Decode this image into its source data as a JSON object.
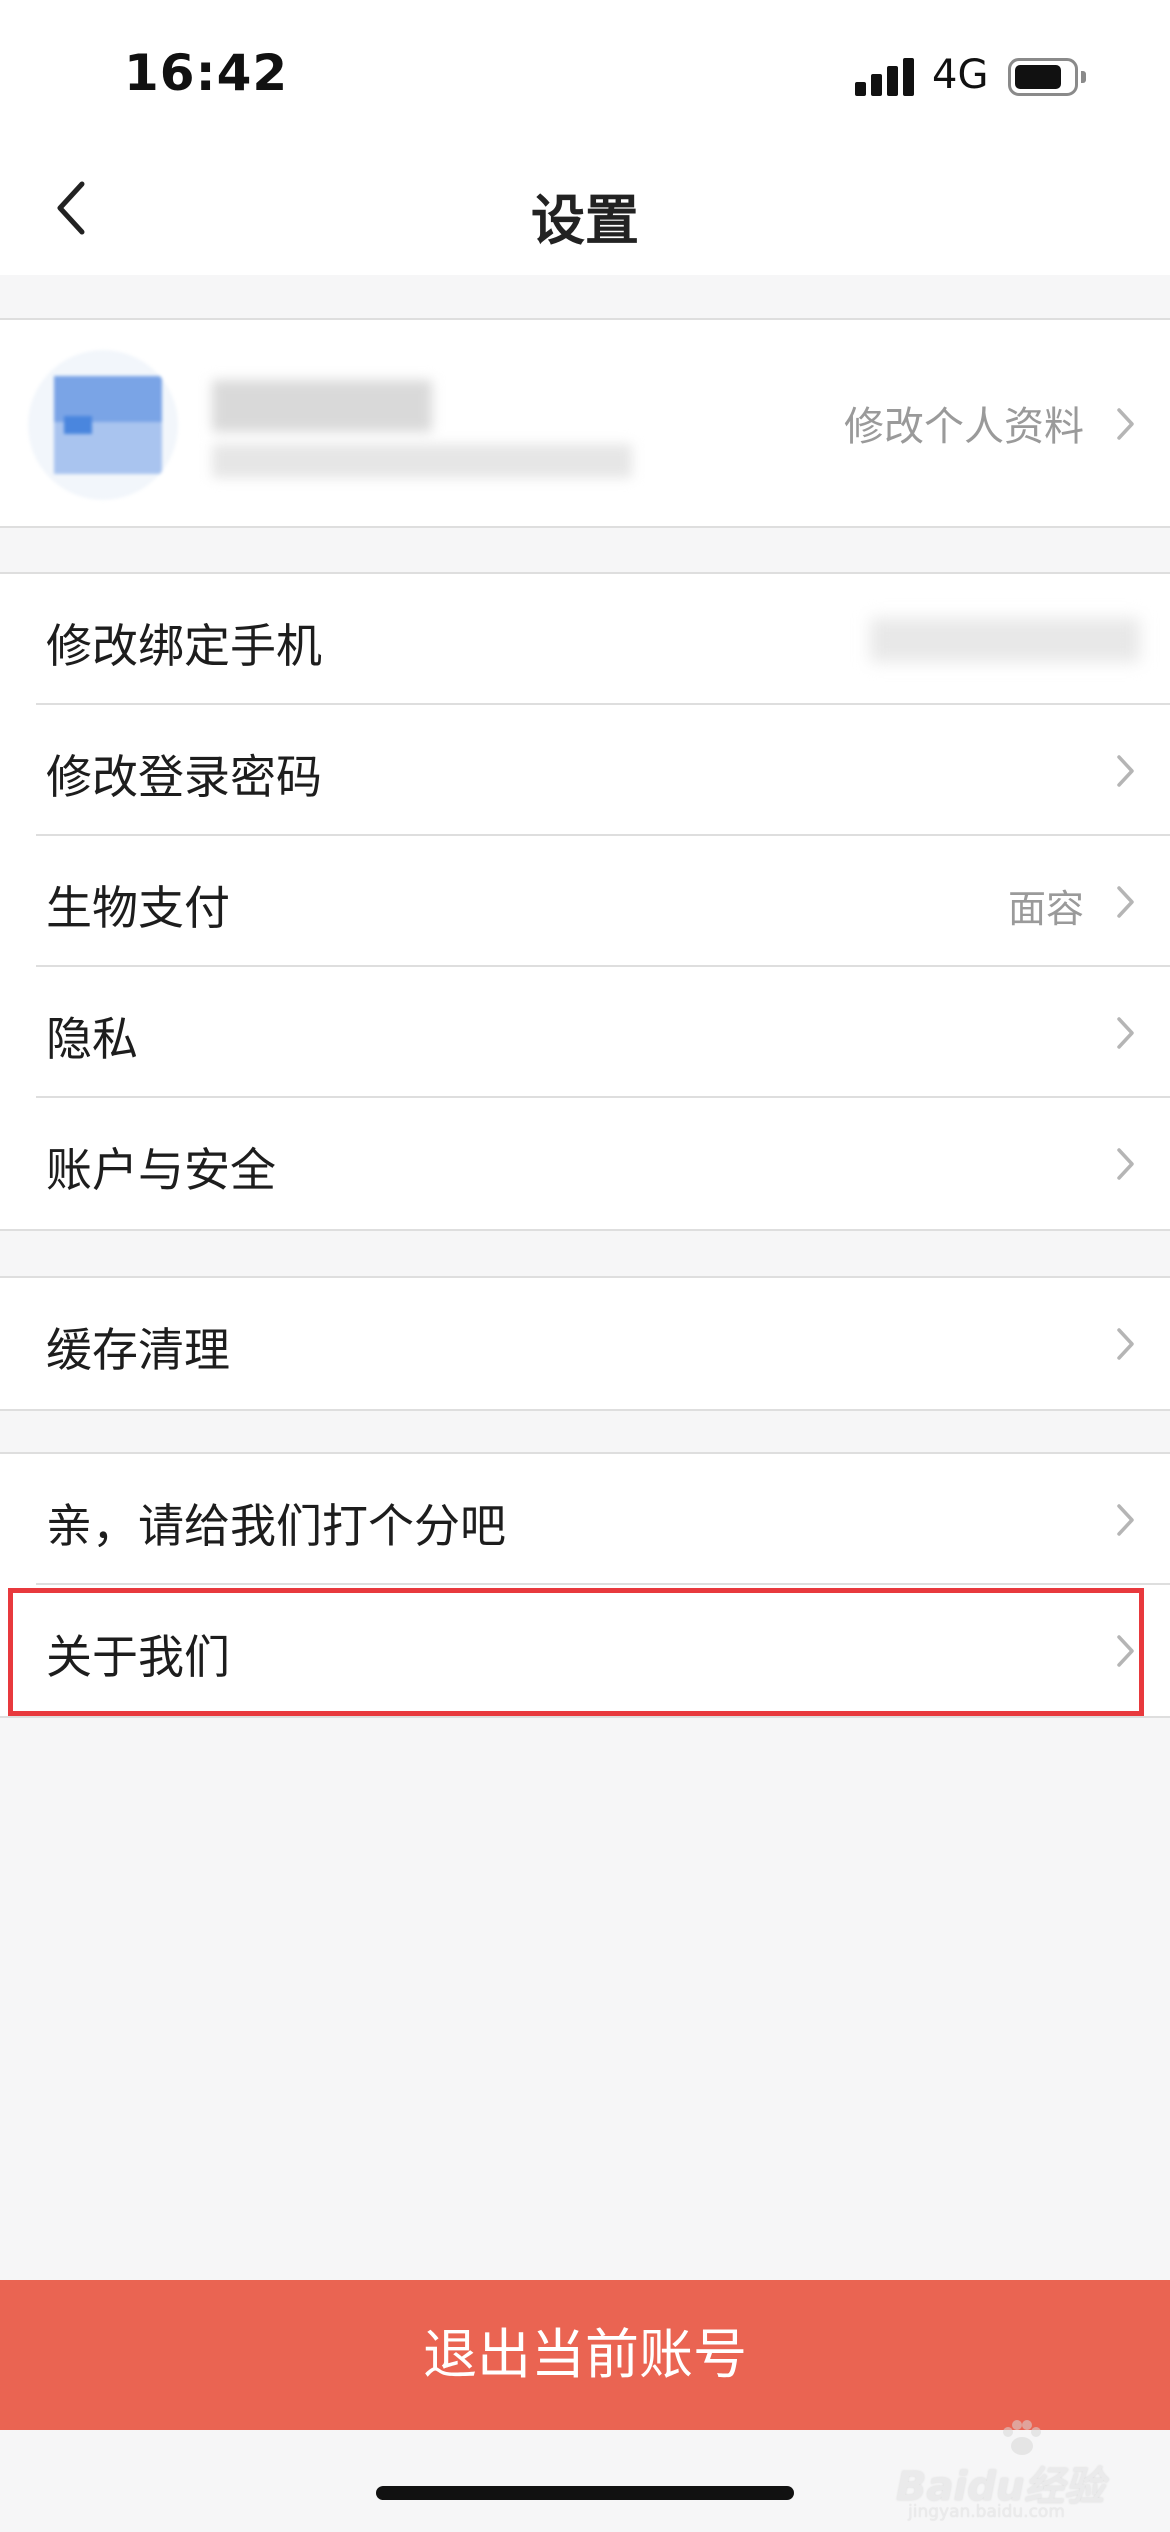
{
  "status_bar": {
    "time": "16:42",
    "network": "4G"
  },
  "header": {
    "title": "设置"
  },
  "profile": {
    "edit_label": "修改个人资料"
  },
  "groups": {
    "account": [
      {
        "label": "修改绑定手机",
        "value": ""
      },
      {
        "label": "修改登录密码",
        "value": ""
      },
      {
        "label": "生物支付",
        "value": "面容"
      },
      {
        "label": "隐私",
        "value": ""
      },
      {
        "label": "账户与安全",
        "value": ""
      }
    ],
    "storage": [
      {
        "label": "缓存清理",
        "value": ""
      }
    ],
    "about": [
      {
        "label": "亲，请给我们打个分吧",
        "value": ""
      },
      {
        "label": "关于我们",
        "value": ""
      }
    ]
  },
  "logout": {
    "label": "退出当前账号"
  },
  "watermark": {
    "text": "Baidu经验",
    "subtext": "jingyan.baidu.com"
  },
  "colors": {
    "logout_background": "#ea6452",
    "highlight_border": "#e8393d",
    "page_background": "#f6f6f7"
  }
}
